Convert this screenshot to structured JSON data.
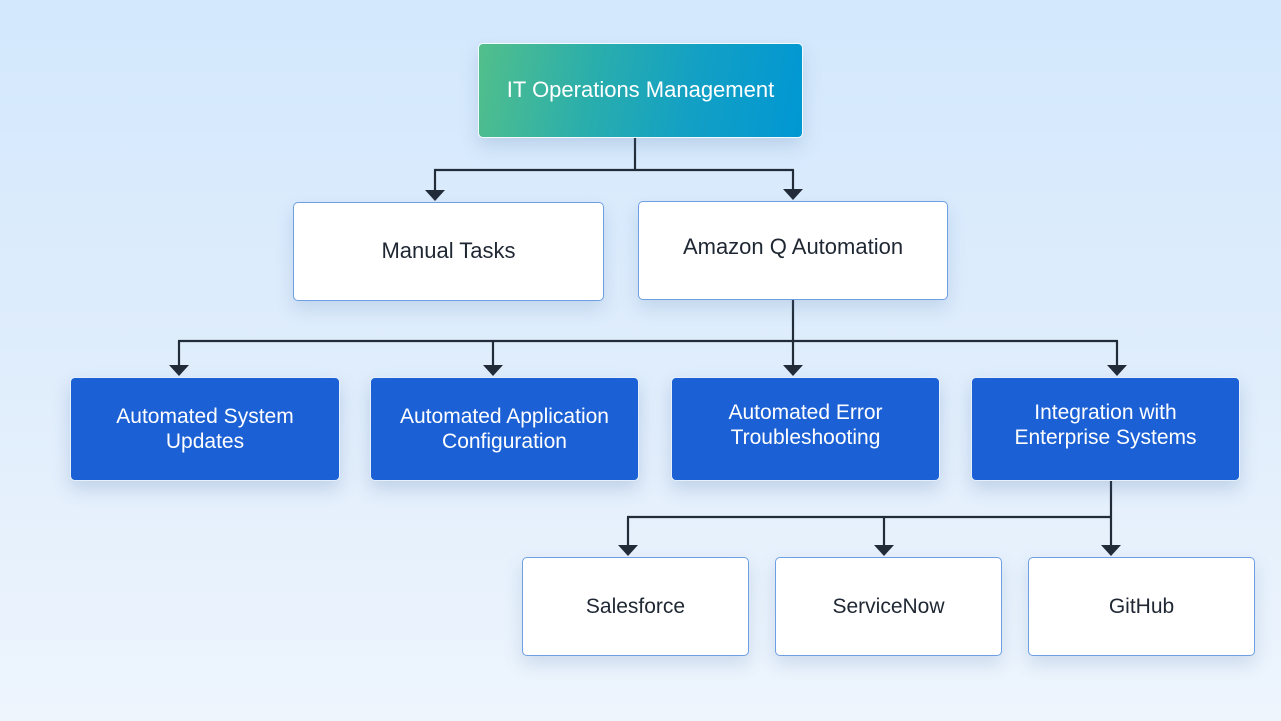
{
  "diagram": {
    "type": "hierarchy-flowchart",
    "colors": {
      "root_gradient_start": "#52bf8b",
      "root_gradient_end": "#0097d3",
      "level2_fill": "#ffffff",
      "level2_border": "#6f9fe3",
      "level3_fill": "#1b60d4",
      "connector": "#222b38",
      "background_top": "#d3e8fd",
      "background_bottom": "#eef5fd"
    },
    "root": {
      "id": "itom",
      "label": "IT Operations Management"
    },
    "level2": [
      {
        "id": "manual",
        "label": "Manual Tasks",
        "parent": "itom"
      },
      {
        "id": "amazonq",
        "label": "Amazon Q Automation",
        "parent": "itom"
      }
    ],
    "level3": [
      {
        "id": "updates",
        "label": "Automated System\nUpdates",
        "parent": "amazonq"
      },
      {
        "id": "config",
        "label": "Automated Application\nConfiguration",
        "parent": "amazonq"
      },
      {
        "id": "errors",
        "label": "Automated Error\nTroubleshooting",
        "parent": "amazonq"
      },
      {
        "id": "integ",
        "label": "Integration with\nEnterprise Systems",
        "parent": "amazonq"
      }
    ],
    "level4": [
      {
        "id": "salesforce",
        "label": "Salesforce",
        "parent": "integ"
      },
      {
        "id": "servicenow",
        "label": "ServiceNow",
        "parent": "integ"
      },
      {
        "id": "github",
        "label": "GitHub",
        "parent": "integ"
      }
    ],
    "edges": [
      {
        "from": "itom",
        "to": "manual"
      },
      {
        "from": "itom",
        "to": "amazonq"
      },
      {
        "from": "amazonq",
        "to": "updates"
      },
      {
        "from": "amazonq",
        "to": "config"
      },
      {
        "from": "amazonq",
        "to": "errors"
      },
      {
        "from": "amazonq",
        "to": "integ"
      },
      {
        "from": "integ",
        "to": "salesforce"
      },
      {
        "from": "integ",
        "to": "servicenow"
      },
      {
        "from": "integ",
        "to": "github"
      }
    ]
  }
}
